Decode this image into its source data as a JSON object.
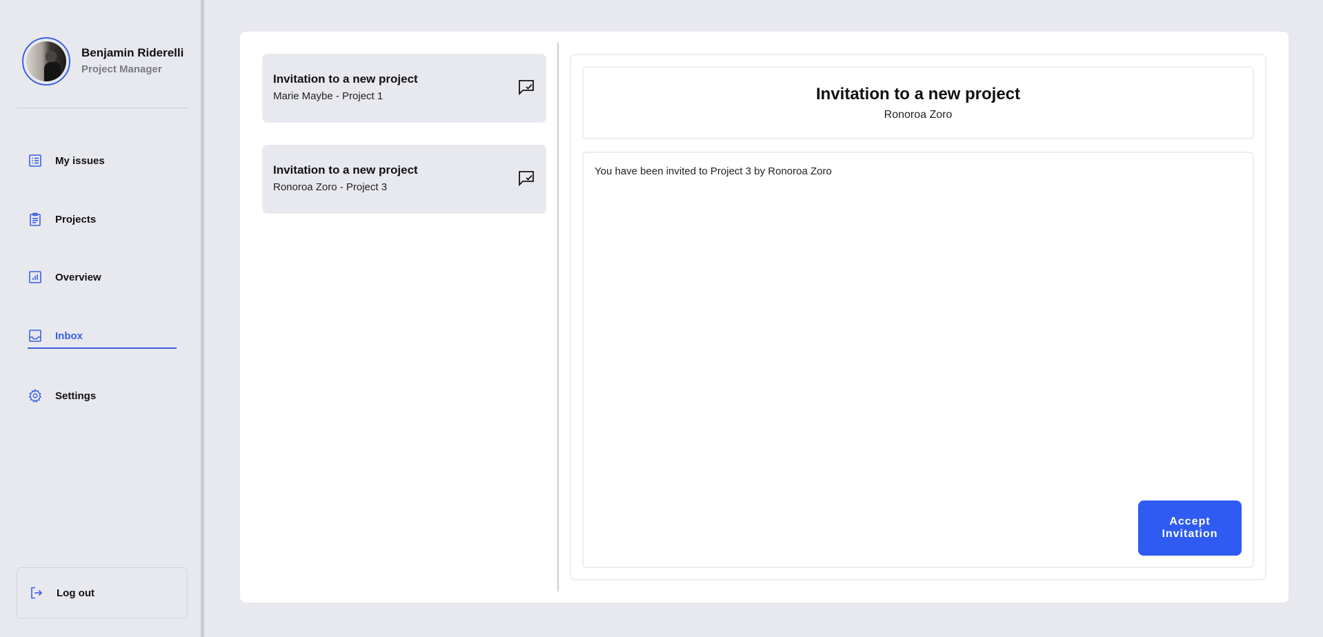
{
  "colors": {
    "accent": "#3b5fe0",
    "button": "#2f5bf2",
    "background": "#e8e9ef",
    "card": "#ffffff"
  },
  "profile": {
    "name": "Benjamin Riderelli",
    "role": "Project Manager"
  },
  "sidebar": {
    "items": [
      {
        "label": "My issues",
        "icon": "list-icon"
      },
      {
        "label": "Projects",
        "icon": "clipboard-icon"
      },
      {
        "label": "Overview",
        "icon": "chart-icon"
      },
      {
        "label": "Inbox",
        "icon": "inbox-icon",
        "active": true
      },
      {
        "label": "Settings",
        "icon": "gear-icon"
      }
    ],
    "logout_label": "Log out"
  },
  "inbox": {
    "messages": [
      {
        "title": "Invitation to a new project",
        "subtitle": "Marie Maybe - Project 1"
      },
      {
        "title": "Invitation to a new project",
        "subtitle": "Ronoroa Zoro - Project 3"
      }
    ]
  },
  "detail": {
    "title": "Invitation to a new project",
    "sender": "Ronoroa Zoro",
    "body": "You have been invited to Project 3 by Ronoroa Zoro",
    "accept_label": "Accept Invitation"
  }
}
